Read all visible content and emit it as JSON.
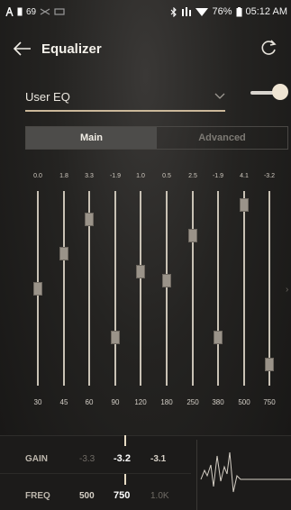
{
  "status": {
    "left_text": "69",
    "battery": "76%",
    "time": "05:12 AM"
  },
  "app": {
    "title": "Equalizer"
  },
  "preset": {
    "name": "User EQ",
    "toggle_on": true
  },
  "tabs": [
    {
      "label": "Main",
      "selected": true
    },
    {
      "label": "Advanced",
      "selected": false
    }
  ],
  "bands": [
    {
      "freq": "30",
      "gain": "0.0",
      "level": 0.5
    },
    {
      "freq": "45",
      "gain": "1.8",
      "level": 0.69
    },
    {
      "freq": "60",
      "gain": "3.3",
      "level": 0.88
    },
    {
      "freq": "90",
      "gain": "-1.9",
      "level": 0.23
    },
    {
      "freq": "120",
      "gain": "1.0",
      "level": 0.59
    },
    {
      "freq": "180",
      "gain": "0.5",
      "level": 0.54
    },
    {
      "freq": "250",
      "gain": "2.5",
      "level": 0.79
    },
    {
      "freq": "380",
      "gain": "-1.9",
      "level": 0.23
    },
    {
      "freq": "500",
      "gain": "4.1",
      "level": 0.96
    },
    {
      "freq": "750",
      "gain": "-3.2",
      "level": 0.08
    }
  ],
  "bottom": {
    "gain_label": "GAIN",
    "gain_prev": "-3.3",
    "gain_current": "-3.2",
    "gain_next": "-3.1",
    "freq_label": "FREQ",
    "freq_prev": "500",
    "freq_current": "750",
    "freq_next": "1.0K"
  },
  "colors": {
    "accent": "#cbb89a",
    "handle": "#9a9389",
    "track": "#c9c2b5"
  }
}
